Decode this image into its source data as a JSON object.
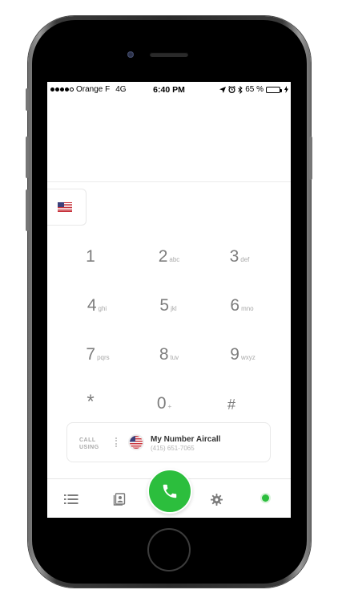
{
  "status_bar": {
    "carrier": "Orange F",
    "network": "4G",
    "time": "6:40 PM",
    "battery": "65 %",
    "battery_level": 0.65,
    "icons": [
      "location-arrow-icon",
      "alarm-icon",
      "bluetooth-icon",
      "charging-bolt-icon"
    ]
  },
  "country": {
    "flag": "us-flag-icon"
  },
  "keypad": [
    {
      "digit": "1",
      "letters": ""
    },
    {
      "digit": "2",
      "letters": "abc"
    },
    {
      "digit": "3",
      "letters": "def"
    },
    {
      "digit": "4",
      "letters": "ghi"
    },
    {
      "digit": "5",
      "letters": "jkl"
    },
    {
      "digit": "6",
      "letters": "mno"
    },
    {
      "digit": "7",
      "letters": "pqrs"
    },
    {
      "digit": "8",
      "letters": "tuv"
    },
    {
      "digit": "9",
      "letters": "wxyz"
    },
    {
      "digit": "*",
      "letters": ""
    },
    {
      "digit": "0",
      "letters": "+"
    },
    {
      "digit": "#",
      "letters": ""
    }
  ],
  "call_using": {
    "label_line1": "CALL",
    "label_line2": "USING",
    "line_name": "My Number Aircall",
    "line_number": "(415) 651-7065"
  },
  "tabbar": {
    "items": [
      "list-icon",
      "contacts-icon",
      "phone-icon",
      "gear-icon",
      "status-dot"
    ]
  },
  "colors": {
    "call_green": "#2cbe3d",
    "battery_green": "#4cd964",
    "key_gray": "#7d7d7d"
  }
}
